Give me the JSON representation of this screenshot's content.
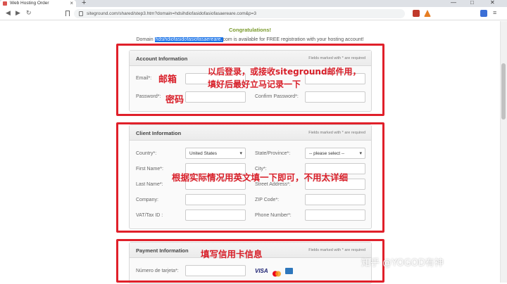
{
  "browser": {
    "tab_title": "Web Hosting Order",
    "tab_close": "×",
    "new_tab": "+",
    "url": "siteground.com/shared/step3.htm?domain=hdsihdiofasidofasiofasaereare.com&p=3",
    "win_min": "—",
    "win_max": "□",
    "win_close": "✕"
  },
  "page": {
    "congrats": "Congratulations!",
    "domain_prefix": "Domain ",
    "domain_highlight": "hdsihdiofasidofasiofasaereare.",
    "domain_suffix": "com is available for FREE registration with your hosting account!"
  },
  "account": {
    "title": "Account Information",
    "note": "Fields marked with * are required",
    "email_label": "Email*:",
    "password_label": "Password*:",
    "confirm_label": "Confirm Password*:"
  },
  "client": {
    "title": "Client Information",
    "note": "Fields marked with * are required",
    "country_label": "Country*:",
    "country_value": "United States",
    "state_label": "State/Province*:",
    "state_value": "-- please select --",
    "first_label": "First Name*:",
    "city_label": "City*:",
    "last_label": "Last Name*:",
    "street_label": "Street Address*:",
    "company_label": "Company:",
    "zip_label": "ZIP Code*:",
    "vat_label": "VAT/Tax ID :",
    "phone_label": "Phone Number*:"
  },
  "payment": {
    "title": "Payment Information",
    "note": "Fields marked with * are required",
    "card_label": "Número de tarjeta*:",
    "visa": "VISA"
  },
  "annotations": {
    "email": "邮箱",
    "password": "密码",
    "account_tip_line1": "以后登录，或接收siteground邮件用，",
    "account_tip_line2": "填好后最好立马记录一下",
    "client_tip": "根据实际情况用英文填一下即可，不用太详细",
    "payment_tip": "填写信用卡信息"
  },
  "watermark": "知乎 @YOGOD有神",
  "colors": {
    "annotation_red": "#d81e28",
    "box_red": "#e0202a",
    "congrats_green": "#7a9a2c",
    "highlight_blue": "#1a73e8"
  }
}
